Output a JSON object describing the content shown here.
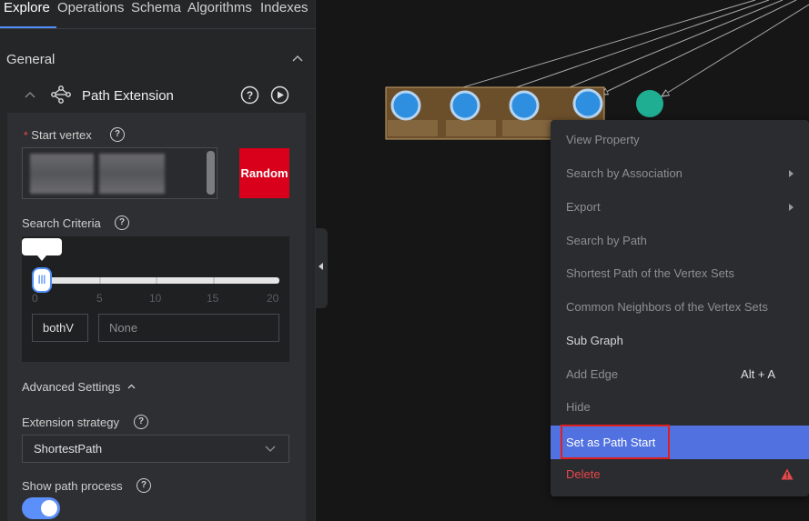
{
  "tabs": [
    {
      "label": "Explore",
      "active": true
    },
    {
      "label": "Operations",
      "active": false
    },
    {
      "label": "Schema",
      "active": false
    },
    {
      "label": "Algorithms",
      "active": false
    },
    {
      "label": "Indexes",
      "active": false
    }
  ],
  "sections": {
    "general_label": "General",
    "path_extension_label": "Path Extension"
  },
  "form": {
    "start_vertex_required_mark": "*",
    "start_vertex_label": "Start vertex",
    "random_button": "Random",
    "search_criteria_label": "Search Criteria",
    "slider": {
      "value": 0,
      "min": 0,
      "max": 20,
      "ticks": [
        "0",
        "5",
        "10",
        "15",
        "20"
      ],
      "handle_glyph": "|||"
    },
    "direction_value": "bothV",
    "label_value": "None",
    "advanced_settings_label": "Advanced Settings",
    "extension_strategy_label": "Extension strategy",
    "extension_strategy_value": "ShortestPath",
    "show_path_process_label": "Show path process",
    "show_path_process_enabled": true
  },
  "context_menu": {
    "items": [
      {
        "label": "View Property",
        "enabled": false
      },
      {
        "label": "Search by Association",
        "enabled": false,
        "submenu": true
      },
      {
        "label": "Export",
        "enabled": false,
        "submenu": true
      },
      {
        "label": "Search by Path",
        "enabled": false
      },
      {
        "label": "Shortest Path of the Vertex Sets",
        "enabled": false
      },
      {
        "label": "Common Neighbors of the Vertex Sets",
        "enabled": false
      },
      {
        "label": "Sub Graph",
        "enabled": true
      },
      {
        "label": "Add Edge",
        "enabled": false,
        "shortcut": "Alt + A"
      },
      {
        "label": "Hide",
        "enabled": false
      },
      {
        "label": "Set as Path Start",
        "enabled": true,
        "active": true
      },
      {
        "label": "Delete",
        "enabled": true,
        "danger": true
      }
    ]
  },
  "colors": {
    "accent": "#5b8ff9",
    "menu_active": "#5171e0",
    "random_button": "#d9001b",
    "danger": "#e84749",
    "vertex_selected": "#2e8fe0",
    "vertex_other": "#1fae91",
    "selection_box": "#6b4f2a"
  },
  "icons": {
    "path_extension": "graph-nodes-icon",
    "help": "question-circle-icon",
    "run": "play-circle-icon",
    "warning": "warning-triangle-icon"
  }
}
